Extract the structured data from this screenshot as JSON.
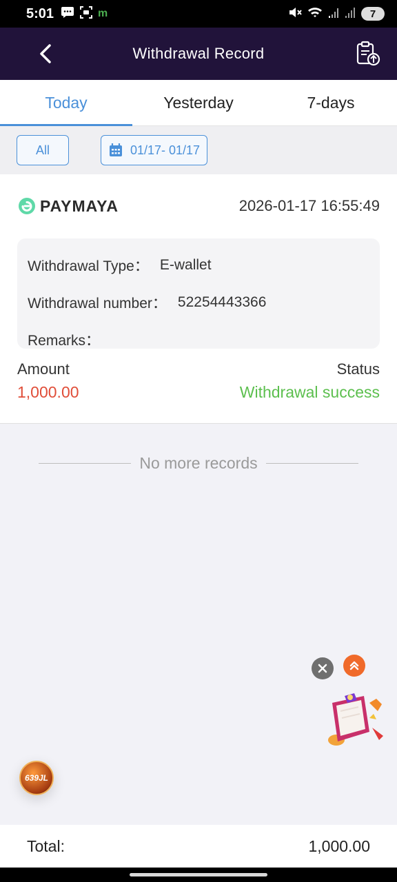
{
  "status_bar": {
    "time": "5:01",
    "battery": "7",
    "app_letter": "m"
  },
  "header": {
    "title": "Withdrawal Record"
  },
  "tabs": [
    {
      "label": "Today",
      "active": true
    },
    {
      "label": "Yesterday",
      "active": false
    },
    {
      "label": "7-days",
      "active": false
    }
  ],
  "filters": {
    "all_label": "All",
    "date_range": "01/17- 01/17"
  },
  "record": {
    "brand": "PAYMAYA",
    "datetime": "2026-01-17 16:55:49",
    "type_label": "Withdrawal Type：",
    "type_value": "E-wallet",
    "number_label": "Withdrawal number：",
    "number_value": "52254443366",
    "remarks_label": "Remarks：",
    "remarks_value": "",
    "amount_label": "Amount",
    "amount_value": "1,000.00",
    "status_label": "Status",
    "status_value": "Withdrawal success"
  },
  "no_more": "No more records",
  "app_badge": "639JL",
  "footer": {
    "total_label": "Total:",
    "total_value": "1,000.00"
  },
  "colors": {
    "header_bg": "#21133a",
    "accent": "#4a90d9",
    "amount": "#e04d38",
    "success": "#5cbf4e"
  }
}
